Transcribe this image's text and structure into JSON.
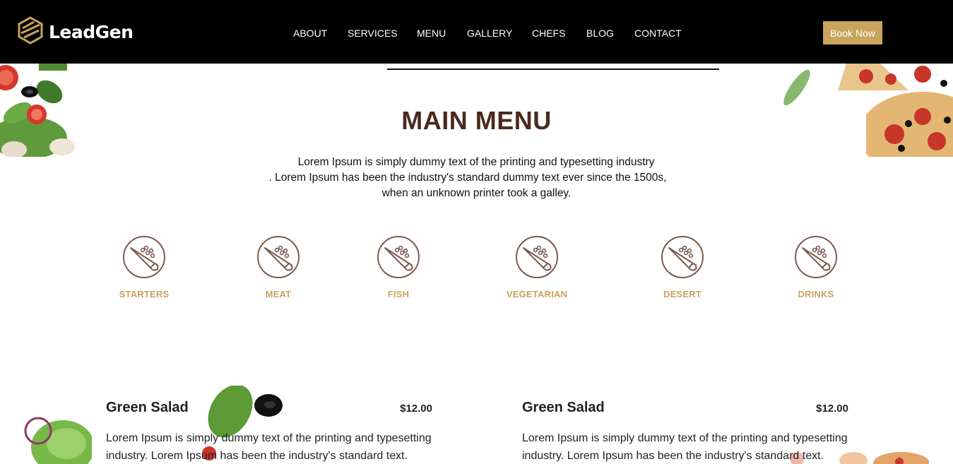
{
  "brand": {
    "name": "LeadGen"
  },
  "nav": {
    "items": [
      "ABOUT",
      "SERVICES",
      "MENU",
      "GALLERY",
      "CHEFS",
      "BLOG",
      "CONTACT"
    ],
    "cta": "Book Now"
  },
  "hero": {
    "title": "MAIN MENU",
    "lines": [
      "Lorem Ipsum is simply dummy text of the printing and typesetting industry",
      ". Lorem Ipsum has been the industry's standard dummy text ever since the 1500s,",
      "when an unknown printer took a galley."
    ]
  },
  "categories": [
    {
      "label": "STARTERS",
      "icon": "carrot-plate-icon"
    },
    {
      "label": "MEAT",
      "icon": "carrot-plate-icon"
    },
    {
      "label": "FISH",
      "icon": "carrot-plate-icon"
    },
    {
      "label": "VEGETARIAN",
      "icon": "carrot-plate-icon"
    },
    {
      "label": "DESERT",
      "icon": "carrot-plate-icon"
    },
    {
      "label": "DRINKS",
      "icon": "carrot-plate-icon"
    }
  ],
  "menu_items": [
    {
      "name": "Green Salad",
      "price": "$12.00",
      "description": "Lorem Ipsum is simply dummy text of the printing and typesetting industry. Lorem Ipsum has been the industry's standard text."
    },
    {
      "name": "Green Salad",
      "price": "$12.00",
      "description": "Lorem Ipsum is simply dummy text of the printing and typesetting industry. Lorem Ipsum has been the industry's standard text."
    }
  ],
  "colors": {
    "header_bg": "#000000",
    "accent_gold": "#c9a45c",
    "title_brown": "#4a2a1e",
    "icon_brown": "#7a5a50"
  }
}
